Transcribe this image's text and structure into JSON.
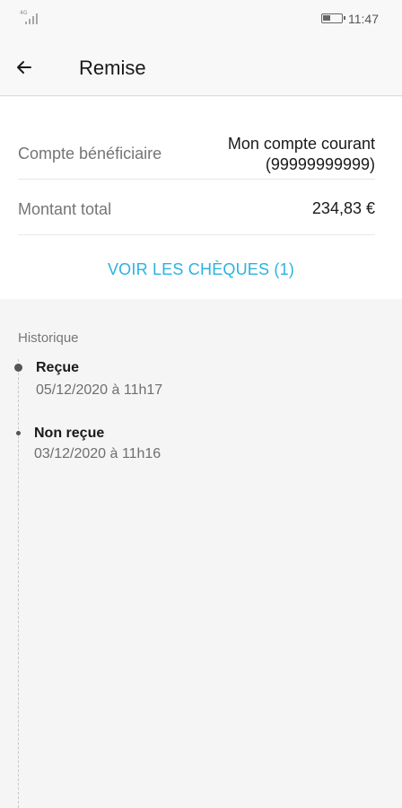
{
  "status_bar": {
    "network_label": "4G",
    "time": "11:47"
  },
  "app_bar": {
    "title": "Remise"
  },
  "details": {
    "beneficiary_label": "Compte bénéficiaire",
    "beneficiary_value_line1": "Mon compte courant",
    "beneficiary_value_line2": "(99999999999)",
    "amount_label": "Montant total",
    "amount_value": "234,83 €",
    "view_cheques_label": "VOIR LES CHÈQUES (1)"
  },
  "history": {
    "title": "Historique",
    "events": [
      {
        "title": "Reçue",
        "date": "05/12/2020 à 11h17"
      },
      {
        "title": "Non reçue",
        "date": "03/12/2020 à 11h16"
      }
    ]
  },
  "colors": {
    "accent": "#2ab3e0",
    "background": "#f5f5f5",
    "card": "#ffffff"
  }
}
